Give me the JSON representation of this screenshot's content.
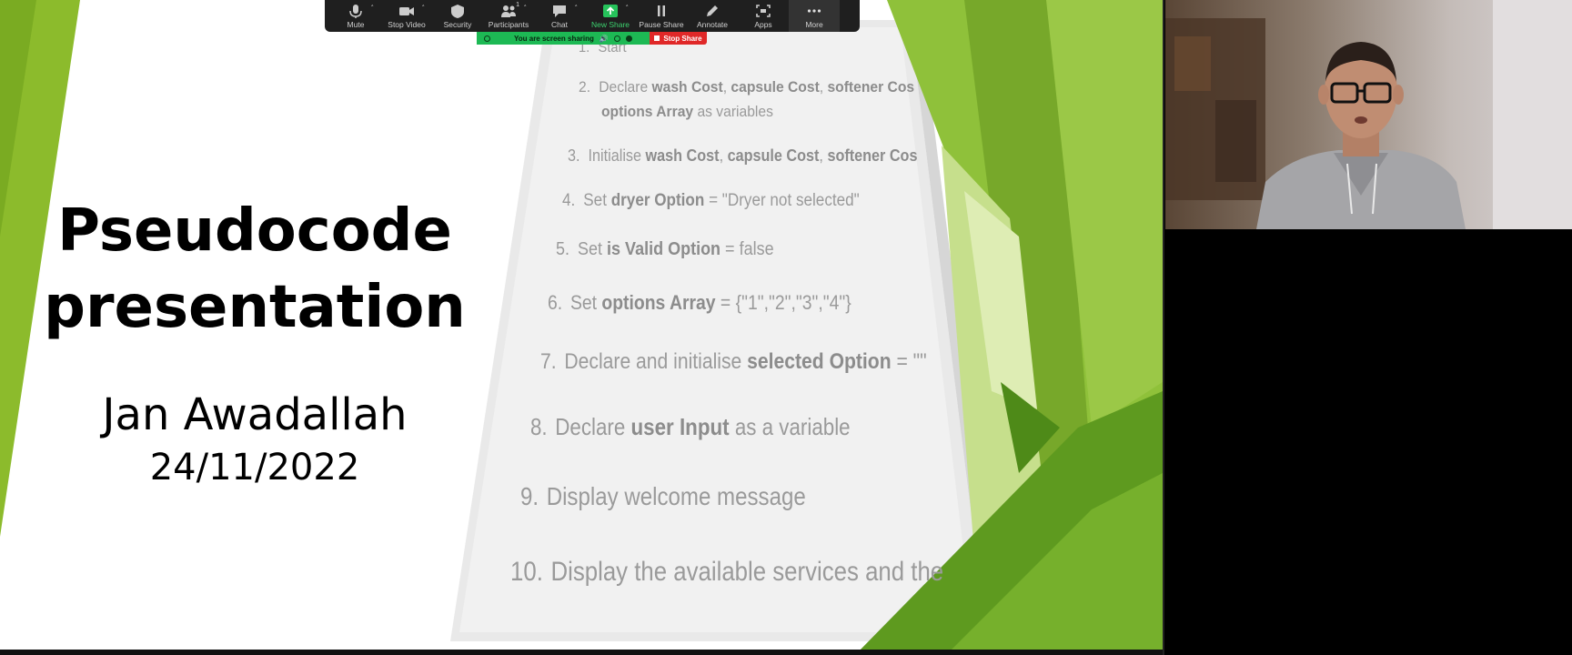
{
  "slide": {
    "title_line1": "Pseudocode",
    "title_line2": "presentation",
    "author": "Jan Awadallah",
    "date": "24/11/2022",
    "pseudocode": [
      {
        "num": "1.",
        "parts": [
          {
            "t": "Start",
            "b": false
          }
        ]
      },
      {
        "num": "2.",
        "parts": [
          {
            "t": "Declare ",
            "b": false
          },
          {
            "t": "wash Cost",
            "b": true
          },
          {
            "t": ", ",
            "b": false
          },
          {
            "t": "capsule Cost",
            "b": true
          },
          {
            "t": ", ",
            "b": false
          },
          {
            "t": "softener Cos",
            "b": true
          }
        ]
      },
      {
        "num": "",
        "parts": [
          {
            "t": "options Array",
            "b": true
          },
          {
            "t": " as variables",
            "b": false
          }
        ]
      },
      {
        "num": "3.",
        "parts": [
          {
            "t": "Initialise ",
            "b": false
          },
          {
            "t": "wash Cost",
            "b": true
          },
          {
            "t": ", ",
            "b": false
          },
          {
            "t": "capsule Cost",
            "b": true
          },
          {
            "t": ", ",
            "b": false
          },
          {
            "t": "softener Cos",
            "b": true
          }
        ]
      },
      {
        "num": "4.",
        "parts": [
          {
            "t": "Set ",
            "b": false
          },
          {
            "t": "dryer Option",
            "b": true
          },
          {
            "t": " = \"Dryer not selected\"",
            "b": false
          }
        ]
      },
      {
        "num": "5.",
        "parts": [
          {
            "t": "Set ",
            "b": false
          },
          {
            "t": "is Valid Option",
            "b": true
          },
          {
            "t": " = false",
            "b": false
          }
        ]
      },
      {
        "num": "6.",
        "parts": [
          {
            "t": "Set ",
            "b": false
          },
          {
            "t": "options Array",
            "b": true
          },
          {
            "t": " = {\"1\",\"2\",\"3\",\"4\"}",
            "b": false
          }
        ]
      },
      {
        "num": "7.",
        "parts": [
          {
            "t": "Declare and initialise ",
            "b": false
          },
          {
            "t": "selected Option",
            "b": true
          },
          {
            "t": " = \"\"",
            "b": false
          }
        ]
      },
      {
        "num": "8.",
        "parts": [
          {
            "t": "Declare ",
            "b": false
          },
          {
            "t": "user Input",
            "b": true
          },
          {
            "t": " as a variable",
            "b": false
          }
        ]
      },
      {
        "num": "9.",
        "parts": [
          {
            "t": "Display welcome message",
            "b": false
          }
        ]
      },
      {
        "num": "10.",
        "parts": [
          {
            "t": "Display the available services and the",
            "b": false
          }
        ]
      }
    ]
  },
  "toolbar": {
    "items": [
      {
        "label": "Mute",
        "icon": "microphone-icon",
        "caret": true
      },
      {
        "label": "Stop Video",
        "icon": "video-camera-icon",
        "caret": true
      },
      {
        "label": "Security",
        "icon": "shield-icon",
        "caret": false
      },
      {
        "label": "Participants",
        "icon": "participants-icon",
        "caret": true,
        "count": "1"
      },
      {
        "label": "Chat",
        "icon": "chat-bubble-icon",
        "caret": true
      },
      {
        "label": "New Share",
        "icon": "share-arrow-icon",
        "caret": true
      },
      {
        "label": "Pause Share",
        "icon": "pause-icon",
        "caret": false
      },
      {
        "label": "Annotate",
        "icon": "pencil-icon",
        "caret": false
      },
      {
        "label": "Apps",
        "icon": "apps-icon",
        "caret": false
      },
      {
        "label": "More",
        "icon": "more-dots-icon",
        "caret": false
      }
    ],
    "accent": "#3cd16e"
  },
  "share_bar": {
    "status": "You are screen sharing",
    "stop_label": "Stop Share",
    "status_color": "#1db954",
    "stop_color": "#e02828"
  }
}
